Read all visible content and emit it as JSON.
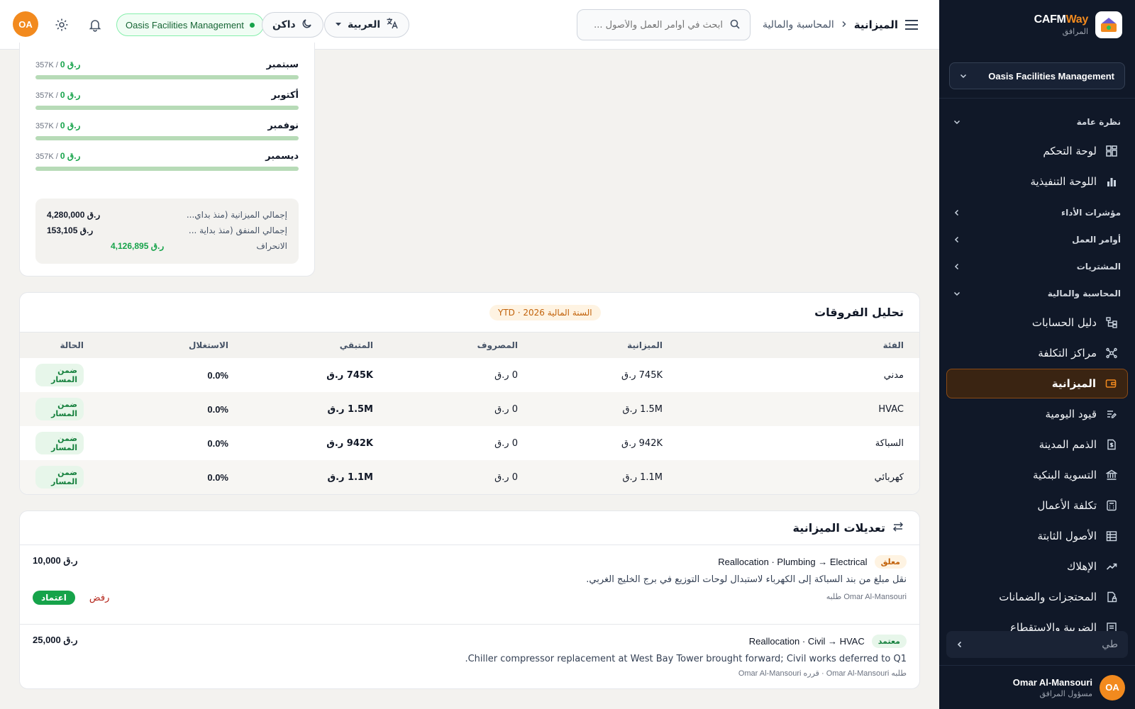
{
  "brand": {
    "name_prefix": "CAFM",
    "name_suffix": "Way",
    "subtitle": "المرافق"
  },
  "org_selector": {
    "value": "Oasis Facilities Management"
  },
  "sidebar": {
    "sections": {
      "overview": "نظرة عامة",
      "kpis": "مؤشرات الأداء",
      "work_orders": "أوامر العمل",
      "procurement": "المشتريات",
      "finance": "المحاسبة والمالية"
    },
    "items": {
      "dashboard": "لوحة التحكم",
      "executive": "اللوحة التنفيذية",
      "chart_of_accounts": "دليل الحسابات",
      "cost_centers": "مراكز التكلفة",
      "budget": "الميزانية",
      "journal": "قيود اليومية",
      "receivables": "الذمم المدينة",
      "bank_rec": "التسوية البنكية",
      "job_costing": "تكلفة الأعمال",
      "fixed_assets": "الأصول الثابتة",
      "depreciation": "الإهلاك",
      "retentions": "المحتجزات والضمانات",
      "tax": "الضريبة والاستقطاع"
    },
    "collapse_label": "طي",
    "user": {
      "initials": "OA",
      "name": "Omar Al-Mansouri",
      "role": "مسؤول المرافق"
    }
  },
  "topbar": {
    "avatar_initials": "OA",
    "org_pill": "Oasis Facilities Management",
    "theme_label": "داكن",
    "language_label": "العربية",
    "search_placeholder": "ابحث في أوامر العمل والأصول ...",
    "breadcrumb_parent": "المحاسبة والمالية",
    "breadcrumb_current": "الميزانية"
  },
  "monthly": {
    "items": [
      {
        "name": "سبتمبر",
        "spent": "0 ر.ق",
        "budget": "357K",
        "progress": 0
      },
      {
        "name": "أكتوبر",
        "spent": "0 ر.ق",
        "budget": "357K",
        "progress": 0
      },
      {
        "name": "نوفمبر",
        "spent": "0 ر.ق",
        "budget": "357K",
        "progress": 0
      },
      {
        "name": "ديسمبر",
        "spent": "0 ر.ق",
        "budget": "357K",
        "progress": 0
      }
    ],
    "totals": {
      "budget_label": "إجمالي الميزانية (منذ بداي...",
      "budget_value": "4,280,000 ر.ق",
      "spent_label": "إجمالي المنفق (منذ بداية ...",
      "spent_value": "153,105 ر.ق",
      "variance_label": "الانحراف",
      "variance_value": "4,126,895 ر.ق"
    }
  },
  "variance": {
    "title": "تحليل الفروقات",
    "badge": "السنة المالية 2026 · YTD",
    "columns": {
      "category": "الفئة",
      "budget": "الميزانية",
      "spent": "المصروف",
      "remaining": "المتبقي",
      "utilization": "الاستغلال",
      "status": "الحالة"
    },
    "rows": [
      {
        "category": "مدني",
        "budget": "745K ر.ق",
        "spent": "0 ر.ق",
        "remaining": "745K ر.ق",
        "utilization": "0.0%",
        "status": "ضمن المسار"
      },
      {
        "category": "HVAC",
        "budget": "1.5M ر.ق",
        "spent": "0 ر.ق",
        "remaining": "1.5M ر.ق",
        "utilization": "0.0%",
        "status": "ضمن المسار"
      },
      {
        "category": "السباكة",
        "budget": "942K ر.ق",
        "spent": "0 ر.ق",
        "remaining": "942K ر.ق",
        "utilization": "0.0%",
        "status": "ضمن المسار"
      },
      {
        "category": "كهربائي",
        "budget": "1.1M ر.ق",
        "spent": "0 ر.ق",
        "remaining": "1.1M ر.ق",
        "utilization": "0.0%",
        "status": "ضمن المسار"
      }
    ]
  },
  "adjustments": {
    "title": "تعديلات الميزانية",
    "items": [
      {
        "status": "معلق",
        "title": "Reallocation · Plumbing → Electrical",
        "amount": "10,000 ر.ق",
        "description": "نقل مبلغ من بند السباكة إلى الكهرباء لاستبدال لوحات التوزيع في برج الخليج الغربي.",
        "meta": "Omar Al-Mansouri طلبه",
        "reject_label": "رفض",
        "approve_label": "اعتماد"
      },
      {
        "status": "معتمد",
        "title": "Reallocation · Civil → HVAC",
        "amount": "25,000 ر.ق",
        "description": "Chiller compressor replacement at West Bay Tower brought forward; Civil works deferred to Q1.",
        "meta": "طلبه Omar Al-Mansouri · قرره Omar Al-Mansouri"
      }
    ]
  }
}
